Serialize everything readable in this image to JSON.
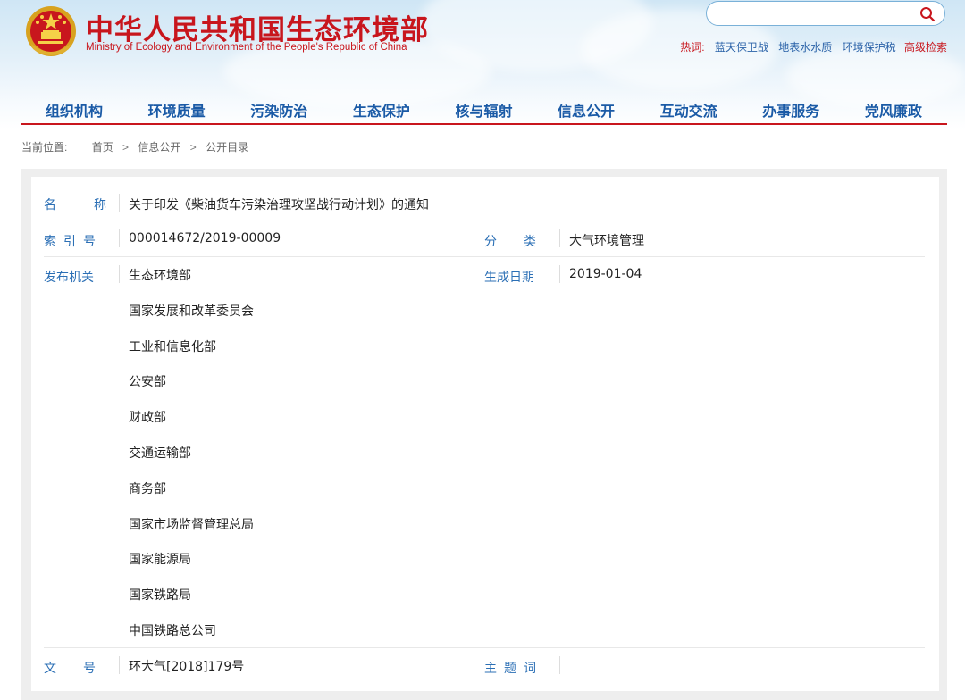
{
  "header": {
    "title_cn": "中华人民共和国生态环境部",
    "title_en": "Ministry of Ecology and Environment of the People's Republic of China",
    "search_placeholder": "",
    "hotwords_label": "热词:",
    "hotwords": [
      "蓝天保卫战",
      "地表水水质",
      "环境保护税"
    ],
    "advanced_search": "高级检索"
  },
  "nav": {
    "items": [
      "组织机构",
      "环境质量",
      "污染防治",
      "生态保护",
      "核与辐射",
      "信息公开",
      "互动交流",
      "办事服务",
      "党风廉政"
    ]
  },
  "breadcrumb": {
    "label": "当前位置:",
    "items": [
      "首页",
      "信息公开",
      "公开目录"
    ],
    "separator": ">"
  },
  "doc": {
    "name_label": "名　称",
    "name_value": "关于印发《柴油货车污染治理攻坚战行动计划》的通知",
    "index_label": "索引号",
    "index_value": "000014672/2019-00009",
    "category_label": "分　类",
    "category_value": "大气环境管理",
    "issuer_label": "发布机关",
    "issuers": [
      "生态环境部",
      "国家发展和改革委员会",
      "工业和信息化部",
      "公安部",
      "财政部",
      "交通运输部",
      "商务部",
      "国家市场监督管理总局",
      "国家能源局",
      "国家铁路局",
      "中国铁路总公司"
    ],
    "date_label": "生成日期",
    "date_value": "2019-01-04",
    "docno_label": "文　号",
    "docno_value": "环大气[2018]179号",
    "keywords_label": "主题词",
    "keywords_value": ""
  },
  "colors": {
    "brand_red": "#c8161d",
    "nav_blue": "#1a5aa6",
    "label_blue": "#2b6fb5"
  }
}
